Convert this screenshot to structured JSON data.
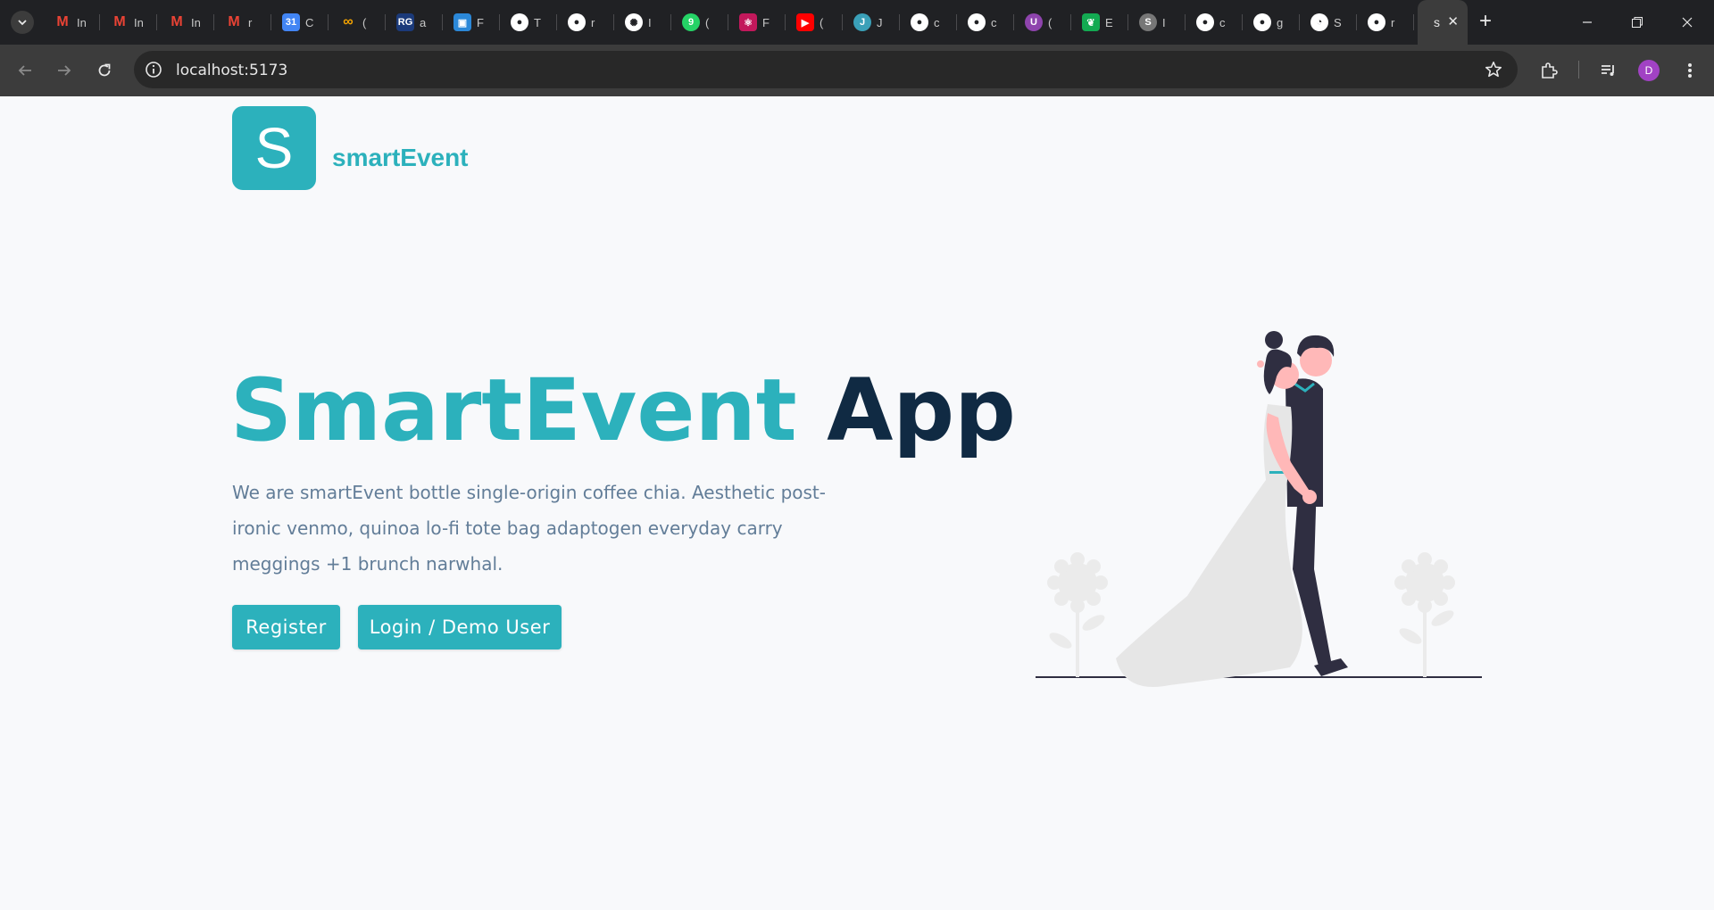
{
  "browser": {
    "tabs": [
      {
        "icon": "gmail-icon",
        "label": "In"
      },
      {
        "icon": "gmail-icon",
        "label": "In"
      },
      {
        "icon": "gmail-icon",
        "label": "In"
      },
      {
        "icon": "gmail-icon",
        "label": "r"
      },
      {
        "icon": "calendar-icon",
        "label": "C"
      },
      {
        "icon": "infinity-icon",
        "label": "("
      },
      {
        "icon": "researchgate-icon",
        "label": "a"
      },
      {
        "icon": "windows-icon",
        "label": "F"
      },
      {
        "icon": "github-icon",
        "label": "T"
      },
      {
        "icon": "github-icon",
        "label": "r"
      },
      {
        "icon": "openai-icon",
        "label": "I"
      },
      {
        "icon": "whatsapp-icon",
        "label": "("
      },
      {
        "icon": "react-icon",
        "label": "F"
      },
      {
        "icon": "youtube-icon",
        "label": "("
      },
      {
        "icon": "j-icon",
        "label": "J"
      },
      {
        "icon": "github-icon",
        "label": "c"
      },
      {
        "icon": "github-icon",
        "label": "c"
      },
      {
        "icon": "u-icon",
        "label": "("
      },
      {
        "icon": "mongodb-icon",
        "label": "E"
      },
      {
        "icon": "s-circle-icon",
        "label": "I"
      },
      {
        "icon": "github-icon",
        "label": "c"
      },
      {
        "icon": "github-icon",
        "label": "g"
      },
      {
        "icon": "gauge-icon",
        "label": "S"
      },
      {
        "icon": "github-icon",
        "label": "r"
      }
    ],
    "active_tab_label": "s",
    "url": "localhost:5173",
    "profile_initial": "D"
  },
  "header": {
    "logo_letter": "S",
    "brand_name": "smartEvent"
  },
  "hero": {
    "title_accent": "SmartEvent",
    "title_rest": "App",
    "description": "We are smartEvent bottle single-origin coffee chia. Aesthetic post-ironic venmo, quinoa lo-fi tote bag adaptogen everyday carry meggings +1 brunch narwhal.",
    "register_label": "Register",
    "login_label": "Login / Demo User"
  },
  "colors": {
    "primary": "#2cb1bc",
    "heading_dark": "#102a43",
    "text_muted": "#627d98",
    "background": "#f8f9fb"
  }
}
